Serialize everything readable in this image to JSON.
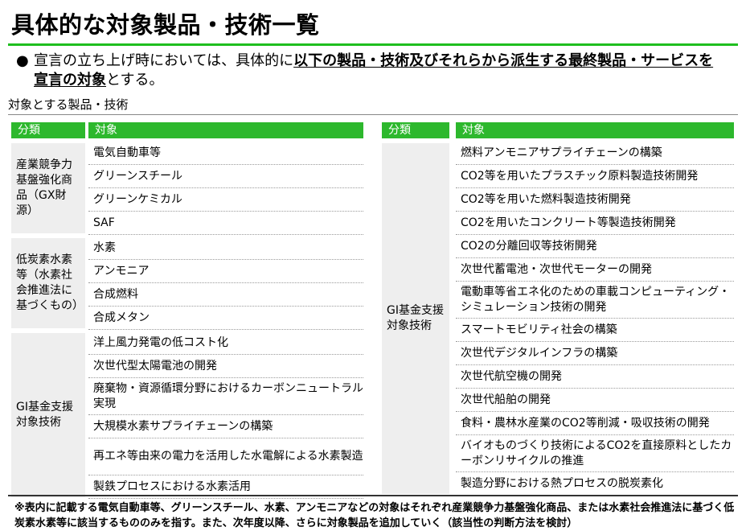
{
  "title": "具体的な対象製品・技術一覧",
  "bullet": {
    "prefix": "宣言の立ち上げ時においては、具体的に",
    "bold": "以下の製品・技術及びそれらから派生する最終製品・サービスを宣言の対象",
    "suffix": "とする。"
  },
  "section_label": "対象とする製品・技術",
  "left_table": {
    "header_category": "分類",
    "header_target": "対象",
    "groups": [
      {
        "category": "産業競争力基盤強化商品（GX財源）",
        "items": [
          "電気自動車等",
          "グリーンスチール",
          "グリーンケミカル",
          "SAF"
        ]
      },
      {
        "category": "低炭素水素等（水素社会推進法に基づくもの）",
        "items": [
          "水素",
          "アンモニア",
          "合成燃料",
          "合成メタン"
        ]
      },
      {
        "category": "GI基金支援対象技術",
        "items": [
          "洋上風力発電の低コスト化",
          "次世代型太陽電池の開発",
          "廃棄物・資源循環分野におけるカーボンニュートラル実現",
          "大規模水素サプライチェーンの構築",
          "再エネ等由来の電力を活用した水電解による水素製造",
          "製鉄プロセスにおける水素活用"
        ]
      }
    ]
  },
  "right_table": {
    "header_category": "分類",
    "header_target": "対象",
    "category": "GI基金支援対象技術",
    "items": [
      "燃料アンモニアサプライチェーンの構築",
      "CO2等を用いたプラスチック原料製造技術開発",
      "CO2等を用いた燃料製造技術開発",
      "CO2を用いたコンクリート等製造技術開発",
      "CO2の分離回収等技術開発",
      "次世代蓄電池・次世代モーターの開発",
      "電動車等省エネ化のための車載コンピューティング・シミュレーション技術の開発",
      "スマートモビリティ社会の構築",
      "次世代デジタルインフラの構築",
      "次世代航空機の開発",
      "次世代船舶の開発",
      "食料・農林水産業のCO2等削減・吸収技術の開発",
      "バイオものづくり技術によるCO2を直接原料としたカーボンリサイクルの推進",
      "製造分野における熱プロセスの脱炭素化"
    ]
  },
  "footnote": "※表内に記載する電気自動車等、グリーンスチール、水素、アンモニアなどの対象はそれぞれ産業競争力基盤強化商品、または水素社会推進法に基づく低炭素水素等に該当するもののみを指す。また、次年度以降、さらに対象製品を追加していく（該当性の判断方法を検討）"
}
